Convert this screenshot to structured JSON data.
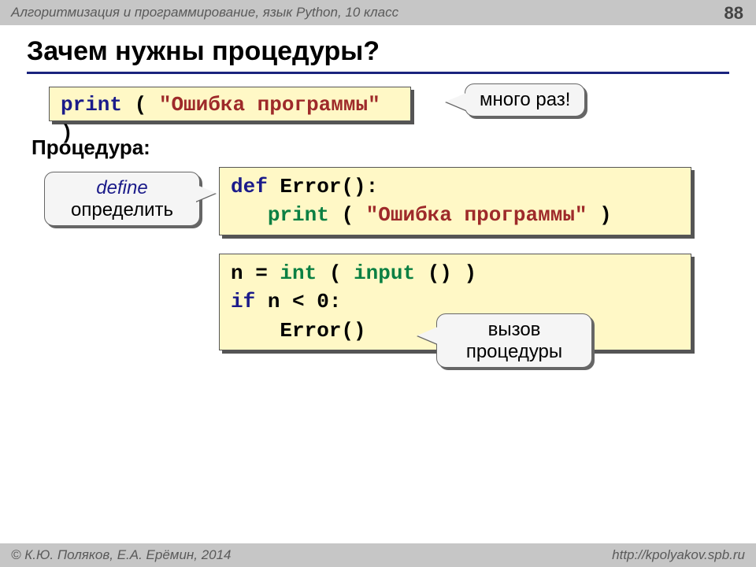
{
  "header": {
    "course": "Алгоритмизация и программирование, язык Python, 10 класс",
    "page": "88"
  },
  "title": "Зачем нужны процедуры?",
  "code1": {
    "print": "print",
    "open": " ( ",
    "str": "\"Ошибка программы\"",
    "close": " )"
  },
  "labels": {
    "procedure": "Процедура:"
  },
  "callouts": {
    "many": "много раз!",
    "define_en": "define",
    "define_ru": "определить",
    "call1": "вызов",
    "call2": "процедуры"
  },
  "code2": {
    "def": "def",
    "sig": " Error():",
    "print": "print",
    "open": "( ",
    "str": "\"Ошибка программы\"",
    "close": " )"
  },
  "code3": {
    "l1a": "n = ",
    "l1b": "int",
    "l1c": " ( ",
    "l1d": "input",
    "l1e": "() )",
    "l2a": "if",
    "l2b": " n < 0:",
    "l3": "Error()"
  },
  "footer": {
    "left": "© К.Ю. Поляков, Е.А. Ерёмин, 2014",
    "right": "http://kpolyakov.spb.ru"
  }
}
